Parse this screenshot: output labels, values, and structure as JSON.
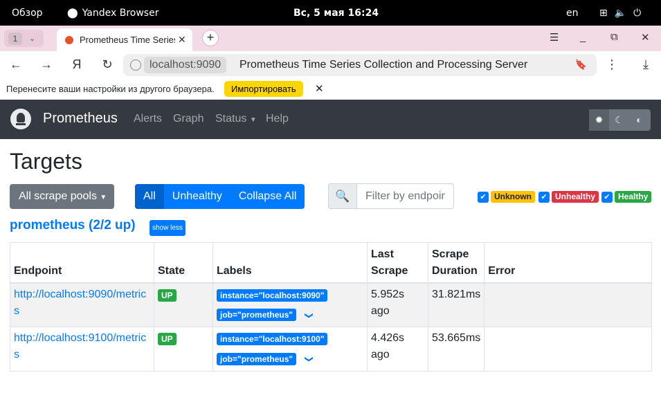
{
  "os": {
    "activities": "Обзор",
    "app_name": "Yandex Browser",
    "clock": "Вс, 5 мая  16:24",
    "lang": "en"
  },
  "browser": {
    "tab_count": "1",
    "tab_title": "Prometheus Time Series Collection and Processing Server",
    "host": "localhost:9090",
    "page_title": "Prometheus Time Series Collection and Processing Server",
    "infobar_message": "Перенесите ваши настройки из другого браузера.",
    "import_label": "Импортировать"
  },
  "nav": {
    "brand": "Prometheus",
    "links": [
      "Alerts",
      "Graph",
      "Status",
      "Help"
    ]
  },
  "page": {
    "title": "Targets",
    "scrape_pools_label": "All scrape pools",
    "filters": [
      "All",
      "Unhealthy",
      "Collapse All"
    ],
    "search_placeholder": "Filter by endpoint or labels",
    "health_filters": [
      {
        "label": "Unknown",
        "color": "#ffc107"
      },
      {
        "label": "Unhealthy",
        "color": "#dc3545"
      },
      {
        "label": "Healthy",
        "color": "#28a745"
      }
    ],
    "pool": {
      "title": "prometheus (2/2 up)",
      "toggle_label": "show less",
      "columns": [
        "Endpoint",
        "State",
        "Labels",
        "Last Scrape",
        "Scrape Duration",
        "Error"
      ],
      "rows": [
        {
          "endpoint": "http://localhost:9090/metrics",
          "state": "UP",
          "labels": [
            "instance=\"localhost:9090\"",
            "job=\"prometheus\""
          ],
          "last_scrape": "5.952s ago",
          "duration": "31.821ms",
          "error": ""
        },
        {
          "endpoint": "http://localhost:9100/metrics",
          "state": "UP",
          "labels": [
            "instance=\"localhost:9100\"",
            "job=\"prometheus\""
          ],
          "last_scrape": "4.426s ago",
          "duration": "53.665ms",
          "error": ""
        }
      ]
    }
  }
}
